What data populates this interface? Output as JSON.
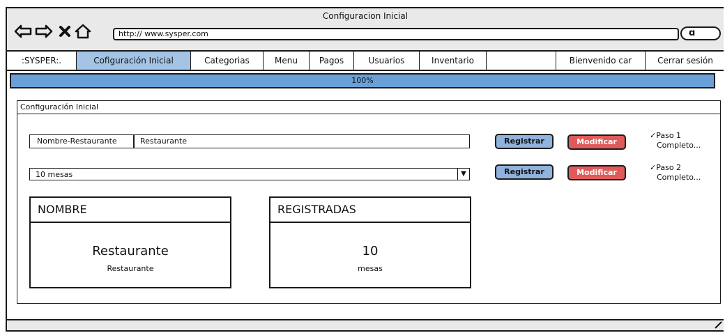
{
  "window": {
    "title": "Configuracion Inicial",
    "url": "http:// www.sysper.com"
  },
  "menu": {
    "items": [
      {
        "label": ":SYSPER:."
      },
      {
        "label": "Cofiguración Inicial",
        "active": true
      },
      {
        "label": "Categorias"
      },
      {
        "label": "Menu"
      },
      {
        "label": "Pagos"
      },
      {
        "label": "Usuarios"
      },
      {
        "label": "Inventario"
      },
      {
        "label": ""
      },
      {
        "label": "Bienvenido car"
      },
      {
        "label": "Cerrar sesión"
      }
    ]
  },
  "progress": {
    "value": 1.0,
    "label": "100%"
  },
  "panel": {
    "title": "Configuración Inicial",
    "row1": {
      "field_label": "Nombre-Restaurante",
      "field_value": "Restaurante",
      "register": "Registrar",
      "modify": "Modificar",
      "status_line1": "Paso 1",
      "status_line2": "Completo..."
    },
    "row2": {
      "select_value": "10 mesas",
      "register": "Registrar",
      "modify": "Modificar",
      "status_line1": "Paso 2",
      "status_line2": "Completo..."
    },
    "card_name": {
      "header": "NOMBRE",
      "big": "Restaurante",
      "small": "Restaurante"
    },
    "card_registered": {
      "header": "REGISTRADAS",
      "big": "10",
      "small": "mesas"
    }
  },
  "colors": {
    "active_tab": "#a4c4e6",
    "progress_fill": "#6aa0d8",
    "register_btn": "#8fb3dd",
    "modify_btn": "#e05a5a"
  }
}
